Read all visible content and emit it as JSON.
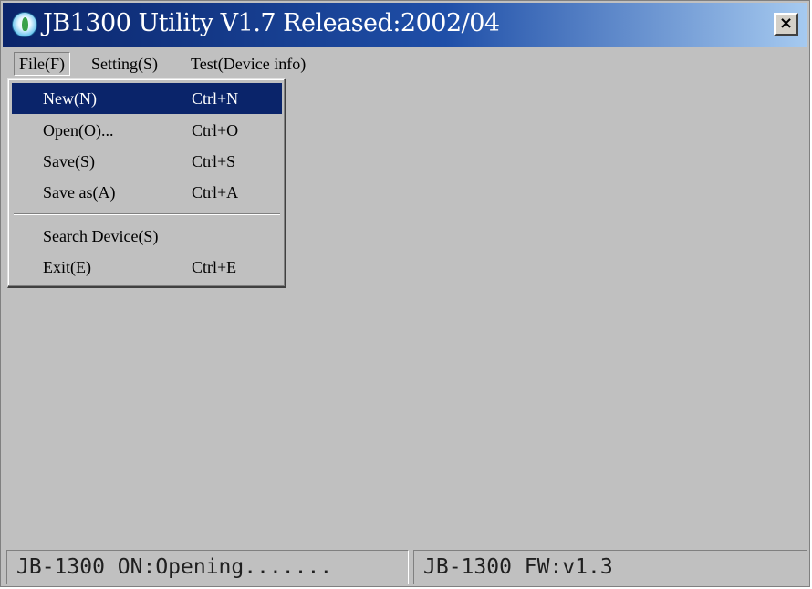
{
  "window": {
    "title": "JB1300 Utility V1.7 Released:2002/04",
    "close_icon": "×"
  },
  "menubar": {
    "items": [
      {
        "label": "File(F)"
      },
      {
        "label": "Setting(S)"
      },
      {
        "label": "Test(Device info)"
      }
    ]
  },
  "file_menu": {
    "items": [
      {
        "label": "New(N)",
        "shortcut": "Ctrl+N",
        "highlighted": true
      },
      {
        "label": "Open(O)...",
        "shortcut": "Ctrl+O"
      },
      {
        "label": "Save(S)",
        "shortcut": "Ctrl+S"
      },
      {
        "label": "Save as(A)",
        "shortcut": "Ctrl+A"
      },
      {
        "label": "Search Device(S)",
        "shortcut": ""
      },
      {
        "label": "Exit(E)",
        "shortcut": "Ctrl+E"
      }
    ]
  },
  "statusbar": {
    "left": "JB-1300 ON:Opening.......",
    "right": "JB-1300 FW:v1.3"
  },
  "colors": {
    "titlebar_start": "#0a246a",
    "titlebar_end": "#a6caf0",
    "highlight": "#0a246a",
    "face": "#c0c0c0"
  },
  "icons": {
    "app": "app-icon",
    "close": "close-icon"
  }
}
